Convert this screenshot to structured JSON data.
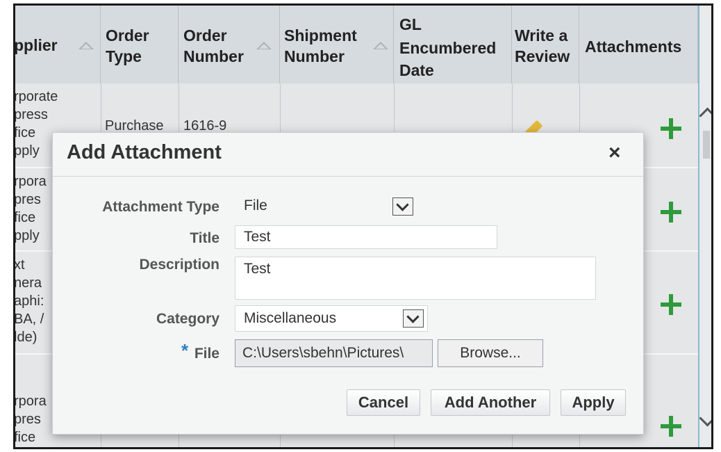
{
  "table": {
    "headers": {
      "supplier": "pplier",
      "order_type_l1": "Order",
      "order_type_l2": "Type",
      "order_number_l1": "Order",
      "order_number_l2": "Number",
      "shipment_l1": "Shipment",
      "shipment_l2": "Number",
      "gl_l1": "GL",
      "gl_l2": "Encumbered",
      "gl_l3": "Date",
      "review_l1": "Write a",
      "review_l2": "Review",
      "attachments": "Attachments"
    },
    "rows": [
      {
        "supplier_lines": [
          "rporate",
          "press",
          "fice",
          "pply"
        ],
        "order_type": "Purchase",
        "order_number": "1616-9"
      },
      {
        "supplier_lines": [
          "rpora",
          "pres",
          "fice",
          "pply"
        ]
      },
      {
        "supplier_lines": [
          "xt",
          "nera",
          "aphi:",
          "BA, /",
          "lde)"
        ]
      },
      {
        "supplier_lines": [
          "rpora",
          "pres",
          "fice"
        ]
      }
    ]
  },
  "dialog": {
    "title": "Add Attachment",
    "close_glyph": "×",
    "attachment_type_label": "Attachment Type",
    "attachment_type_value": "File",
    "title_label": "Title",
    "title_value": "Test",
    "description_label": "Description",
    "description_value": "Test",
    "category_label": "Category",
    "category_value": "Miscellaneous",
    "required_marker": "*",
    "file_label": "File",
    "file_value": "C:\\Users\\sbehn\\Pictures\\",
    "browse_label": "Browse...",
    "cancel_label": "Cancel",
    "add_another_label": "Add Another",
    "apply_label": "Apply"
  },
  "colors": {
    "header_bg": "#d6dbdf",
    "table_bg": "#e4e6e7",
    "plus_icon": "#2f9a3c",
    "required_marker": "#2f7fc1"
  }
}
